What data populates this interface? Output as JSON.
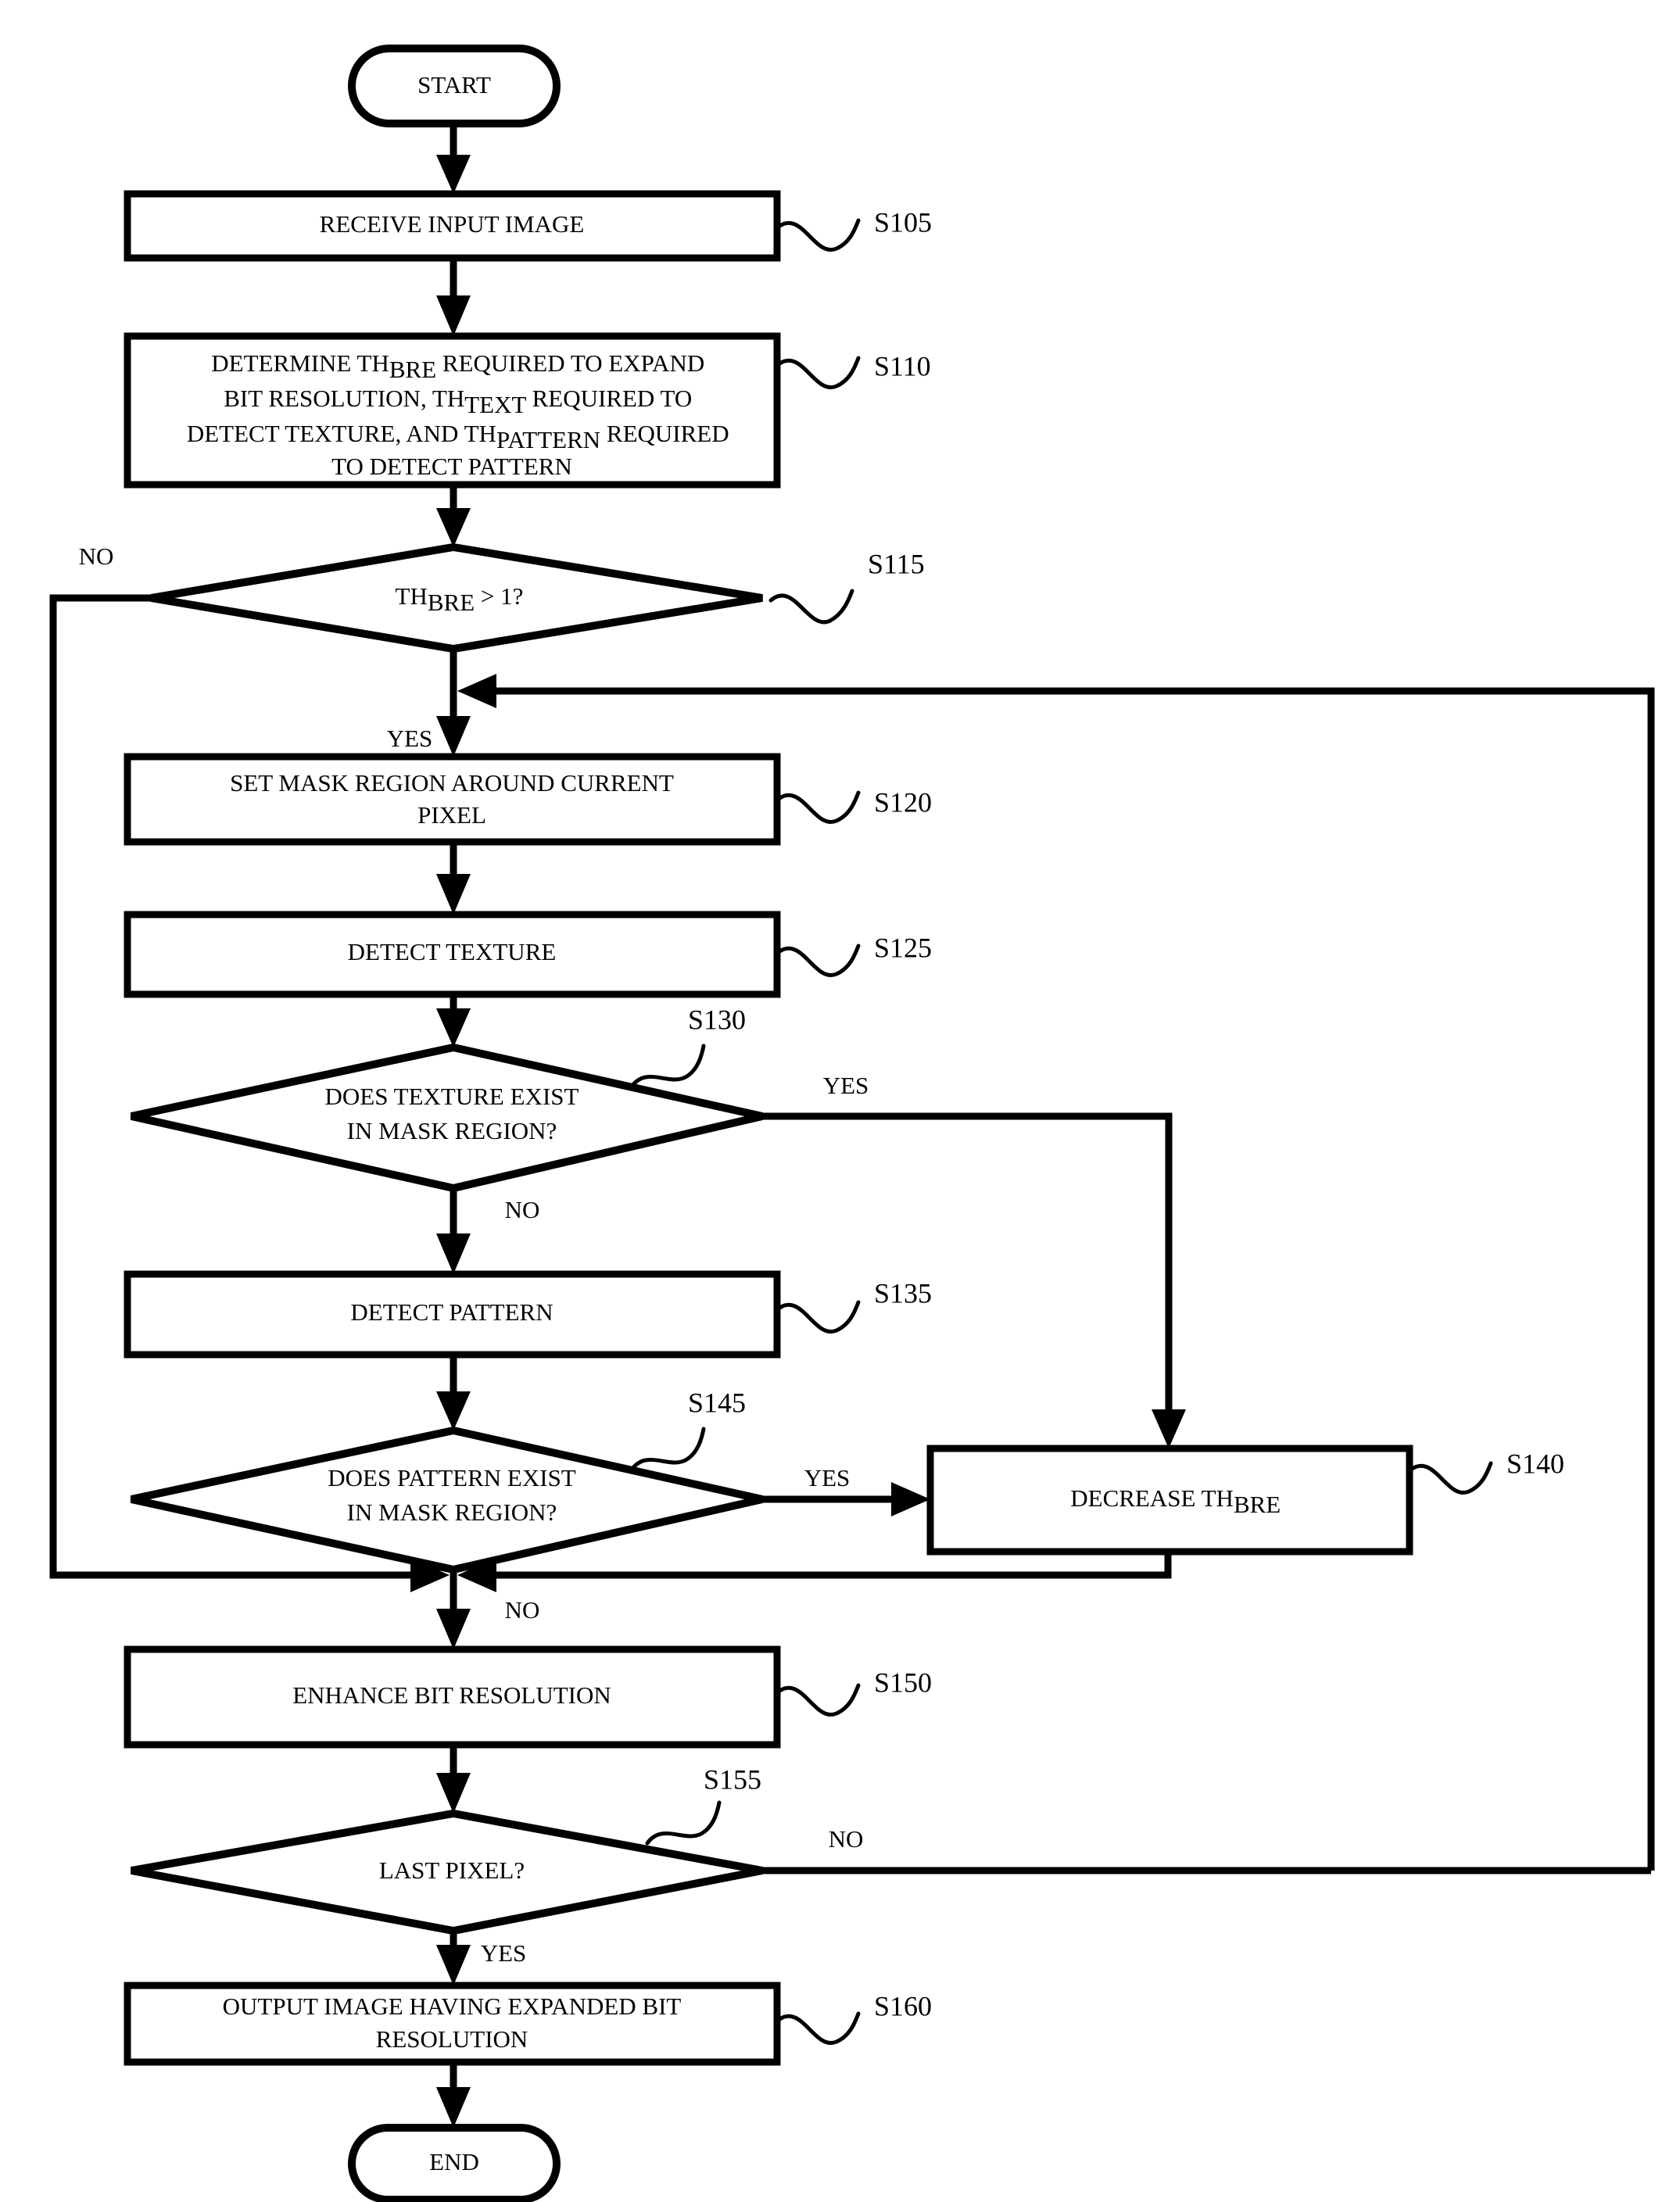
{
  "diagram": {
    "type": "flowchart",
    "title": "Bit resolution expansion process flowchart",
    "terminators": {
      "start": "START",
      "end": "END"
    },
    "nodes": [
      {
        "id": "S105",
        "shape": "process",
        "step": "S105",
        "lines": [
          "RECEIVE INPUT IMAGE"
        ]
      },
      {
        "id": "S110",
        "shape": "process",
        "step": "S110",
        "lines": [
          "DETERMINE TH<BRE> REQUIRED TO EXPAND",
          "BIT RESOLUTION, TH<TEXT> REQUIRED TO",
          "DETECT TEXTURE, AND TH<PATTERN> REQUIRED",
          "TO DETECT PATTERN"
        ],
        "line1_a": "DETERMINE TH",
        "line1_sub": "BRE",
        "line1_b": " REQUIRED TO EXPAND",
        "line2_a": "BIT RESOLUTION, TH",
        "line2_sub": "TEXT",
        "line2_b": " REQUIRED TO",
        "line3_a": "DETECT TEXTURE, AND TH",
        "line3_sub": "PATTERN",
        "line3_b": " REQUIRED",
        "line4": "TO DETECT PATTERN"
      },
      {
        "id": "S115",
        "shape": "decision",
        "step": "S115",
        "text_a": "TH",
        "text_sub": "BRE",
        "text_b": " > 1?",
        "yes_label": "YES",
        "no_label": "NO"
      },
      {
        "id": "S120",
        "shape": "process",
        "step": "S120",
        "line1": "SET MASK REGION AROUND CURRENT",
        "line2": "PIXEL"
      },
      {
        "id": "S125",
        "shape": "process",
        "step": "S125",
        "line1": "DETECT TEXTURE"
      },
      {
        "id": "S130",
        "shape": "decision",
        "step": "S130",
        "line1": "DOES TEXTURE EXIST",
        "line2": "IN MASK REGION?",
        "yes_label": "YES",
        "no_label": "NO"
      },
      {
        "id": "S135",
        "shape": "process",
        "step": "S135",
        "line1": "DETECT PATTERN"
      },
      {
        "id": "S145",
        "shape": "decision",
        "step": "S145",
        "line1": "DOES PATTERN EXIST",
        "line2": "IN MASK REGION?",
        "yes_label": "YES",
        "no_label": "NO"
      },
      {
        "id": "S140",
        "shape": "process",
        "step": "S140",
        "text_a": "DECREASE TH",
        "text_sub": "BRE"
      },
      {
        "id": "S150",
        "shape": "process",
        "step": "S150",
        "line1": "ENHANCE BIT RESOLUTION"
      },
      {
        "id": "S155",
        "shape": "decision",
        "step": "S155",
        "line1": "LAST PIXEL?",
        "yes_label": "YES",
        "no_label": "NO"
      },
      {
        "id": "S160",
        "shape": "process",
        "step": "S160",
        "line1": "OUTPUT IMAGE HAVING EXPANDED BIT",
        "line2": "RESOLUTION"
      }
    ],
    "edge_labels": {
      "s115_no": "NO",
      "s115_yes": "YES",
      "s130_yes": "YES",
      "s130_no": "NO",
      "s145_yes": "YES",
      "s145_no": "NO",
      "s155_no": "NO",
      "s155_yes": "YES"
    },
    "step_labels": {
      "s105": "S105",
      "s110": "S110",
      "s115": "S115",
      "s120": "S120",
      "s125": "S125",
      "s130": "S130",
      "s135": "S135",
      "s140": "S140",
      "s145": "S145",
      "s150": "S150",
      "s155": "S155",
      "s160": "S160"
    },
    "colors": {
      "stroke": "#000000",
      "fill": "#ffffff",
      "text": "#000000"
    }
  }
}
